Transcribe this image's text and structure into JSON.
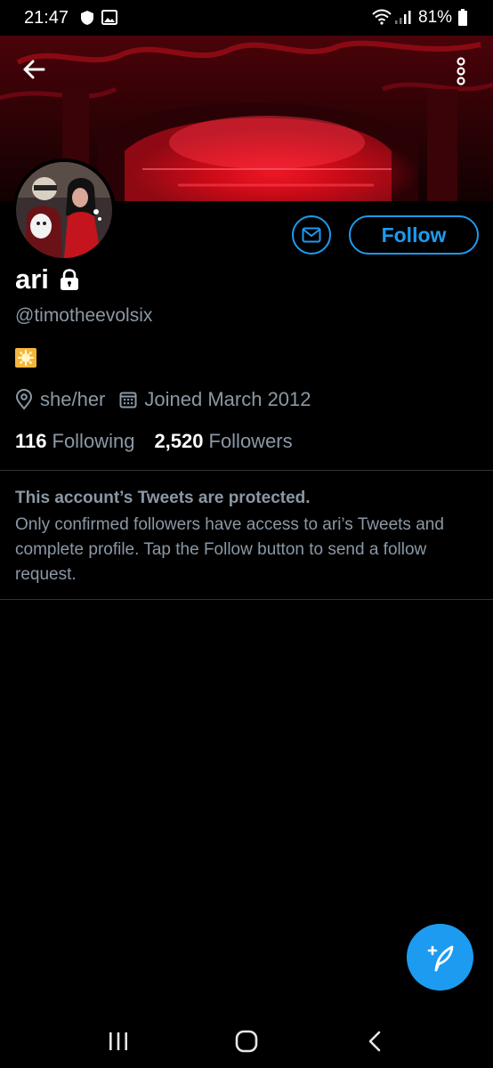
{
  "status_bar": {
    "time": "21:47",
    "battery_percent": "81%",
    "icons": [
      "shield-icon",
      "gallery-icon",
      "wifi-icon",
      "signal-icon",
      "battery-icon"
    ]
  },
  "header": {
    "back_icon": "arrow-left-icon",
    "more_icon": "more-vertical-icon"
  },
  "profile": {
    "display_name": "ari",
    "locked": true,
    "username": "@timotheevolsix",
    "bio_emoji": "sparkle-emoji",
    "pronouns": "she/her",
    "joined": "Joined March 2012",
    "following_count": "116",
    "following_label": "Following",
    "followers_count": "2,520",
    "followers_label": "Followers"
  },
  "actions": {
    "follow_label": "Follow",
    "message_icon": "envelope-icon"
  },
  "protected_notice": {
    "title": "This account’s Tweets are protected.",
    "body": "Only confirmed followers have access to ari’s Tweets and complete profile. Tap the Follow button to send a follow request."
  },
  "compose": {
    "icon": "compose-tweet-icon"
  },
  "colors": {
    "accent": "#1d9bf0",
    "background": "#000000",
    "secondary_text": "#8b98a5",
    "divider": "#2f3336"
  }
}
